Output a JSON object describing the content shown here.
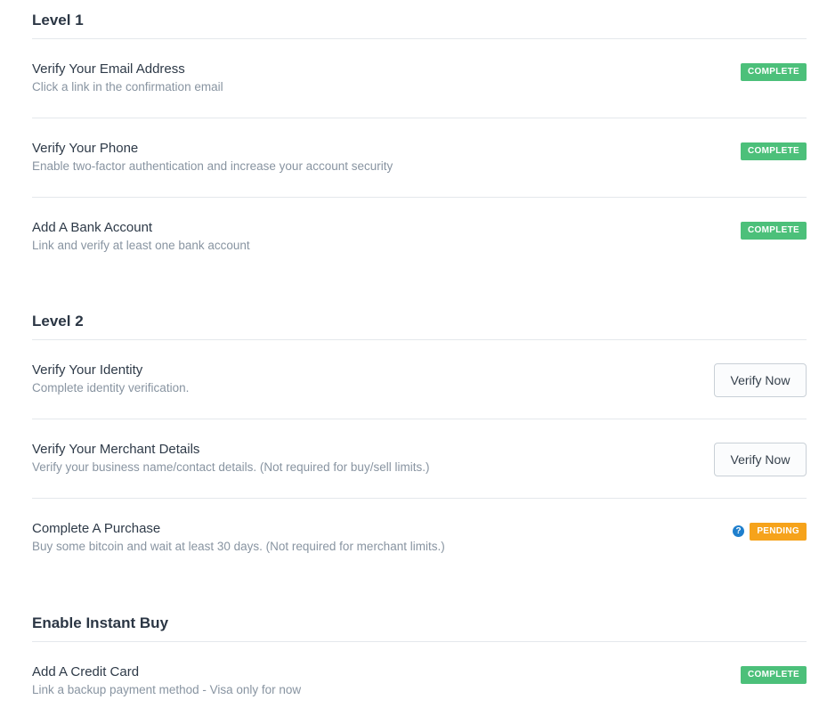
{
  "colors": {
    "complete": "#4cc07a",
    "pending": "#f6a31b",
    "help": "#1f7fcd",
    "divider": "#e4e8ec"
  },
  "sections": [
    {
      "title": "Level 1",
      "items": [
        {
          "title": "Verify Your Email Address",
          "description": "Click a link in the confirmation email",
          "status": "COMPLETE"
        },
        {
          "title": "Verify Your Phone",
          "description": "Enable two-factor authentication and increase your account security",
          "status": "COMPLETE"
        },
        {
          "title": "Add A Bank Account",
          "description": "Link and verify at least one bank account",
          "status": "COMPLETE"
        }
      ]
    },
    {
      "title": "Level 2",
      "items": [
        {
          "title": "Verify Your Identity",
          "description": "Complete identity verification.",
          "button": "Verify Now"
        },
        {
          "title": "Verify Your Merchant Details",
          "description": "Verify your business name/contact details. (Not required for buy/sell limits.)",
          "button": "Verify Now"
        },
        {
          "title": "Complete A Purchase",
          "description": "Buy some bitcoin and wait at least 30 days. (Not required for merchant limits.)",
          "status": "PENDING",
          "help_icon": "question-icon",
          "help_glyph": "?"
        }
      ]
    },
    {
      "title": "Enable Instant Buy",
      "items": [
        {
          "title": "Add A Credit Card",
          "description": "Link a backup payment method - Visa only for now",
          "status": "COMPLETE"
        }
      ]
    }
  ]
}
